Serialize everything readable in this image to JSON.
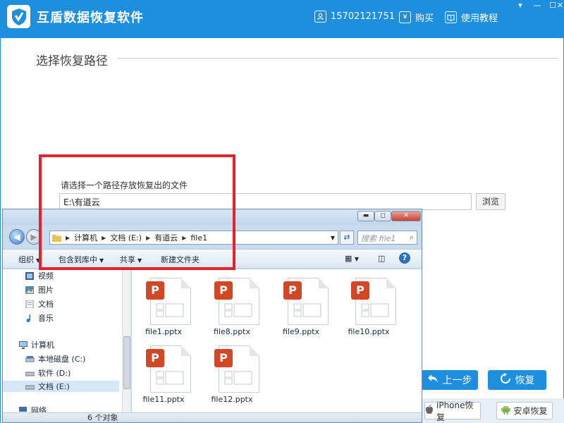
{
  "app": {
    "title": "互盾数据恢复软件",
    "phone": "15702121751",
    "buy_label": "购买",
    "tutorial_label": "使用教程"
  },
  "section": {
    "title": "选择恢复路径",
    "path_label": "请选择一个路径存放恢复出的文件",
    "path_value": "E:\\有道云",
    "browse_label": "浏览"
  },
  "buttons": {
    "prev_label": "上一步",
    "recover_label": "恢复",
    "iphone_label": "iPhone恢复",
    "android_label": "安卓恢复"
  },
  "explorer": {
    "breadcrumb": [
      "计算机",
      "文档 (E:)",
      "有道云",
      "file1"
    ],
    "search_placeholder": "搜索 file1",
    "toolbar": {
      "organize": "组织",
      "include": "包含到库中",
      "share": "共享",
      "new_folder": "新建文件夹"
    },
    "nav": {
      "videos": "视频",
      "pictures": "图片",
      "documents": "文档",
      "music": "音乐",
      "computer": "计算机",
      "drive_c": "本地磁盘 (C:)",
      "drive_d": "软件 (D:)",
      "drive_e": "文档 (E:)",
      "network": "网络"
    },
    "files": [
      "file1.pptx",
      "file8.pptx",
      "file9.pptx",
      "file10.pptx",
      "file11.pptx",
      "file12.pptx"
    ],
    "status": "6 个对象"
  },
  "colors": {
    "brand_blue": "#1e8fde",
    "highlight_red": "#e5212b",
    "pptx_orange": "#d24726"
  }
}
